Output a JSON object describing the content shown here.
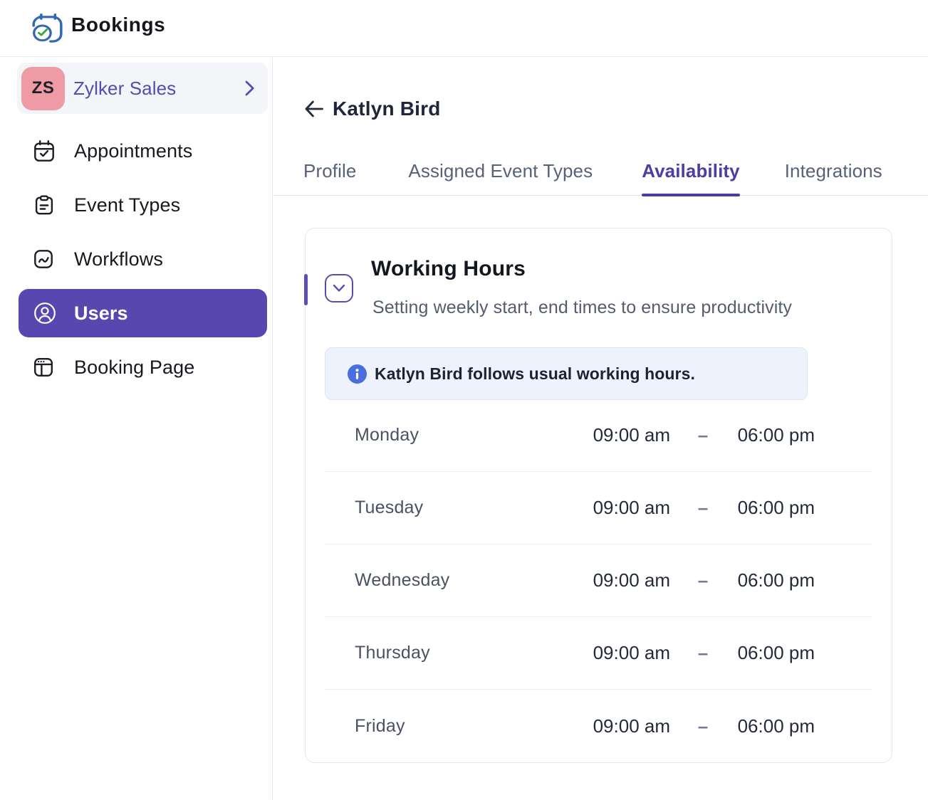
{
  "app": {
    "name": "Bookings"
  },
  "colors": {
    "accent_purple": "#5646ab",
    "link_purple": "#554cb0",
    "tab_active_purple": "#4b3ea4",
    "avatar_pink": "#ee9ba6",
    "notice_blue_bg": "#eef2fc",
    "info_icon_blue": "#4a6ede",
    "logo_blue": "#3468b2",
    "logo_green": "#3ba44a"
  },
  "sidebar": {
    "team": {
      "initials": "ZS",
      "name": "Zylker Sales"
    },
    "items": [
      {
        "label": "Appointments",
        "icon": "calendar-check-icon",
        "active": false
      },
      {
        "label": "Event Types",
        "icon": "clipboard-icon",
        "active": false
      },
      {
        "label": "Workflows",
        "icon": "workflow-icon",
        "active": false
      },
      {
        "label": "Users",
        "icon": "user-icon",
        "active": true
      },
      {
        "label": "Booking Page",
        "icon": "browser-icon",
        "active": false
      }
    ]
  },
  "main": {
    "title": "Katlyn Bird",
    "tabs": [
      {
        "label": "Profile",
        "active": false
      },
      {
        "label": "Assigned Event Types",
        "active": false
      },
      {
        "label": "Availability",
        "active": true
      },
      {
        "label": "Integrations",
        "active": false
      }
    ],
    "working_hours": {
      "title": "Working Hours",
      "subtitle": "Setting weekly start, end times to ensure productivity",
      "notice": "Katlyn Bird follows usual working hours.",
      "days": [
        {
          "day": "Monday",
          "start": "09:00 am",
          "dash": "–",
          "end": "06:00 pm"
        },
        {
          "day": "Tuesday",
          "start": "09:00 am",
          "dash": "–",
          "end": "06:00 pm"
        },
        {
          "day": "Wednesday",
          "start": "09:00 am",
          "dash": "–",
          "end": "06:00 pm"
        },
        {
          "day": "Thursday",
          "start": "09:00 am",
          "dash": "–",
          "end": "06:00 pm"
        },
        {
          "day": "Friday",
          "start": "09:00 am",
          "dash": "–",
          "end": "06:00 pm"
        }
      ]
    }
  }
}
